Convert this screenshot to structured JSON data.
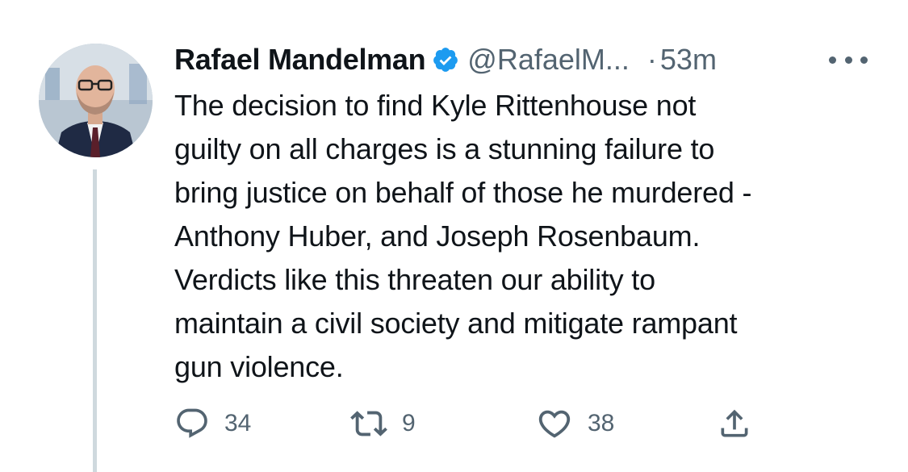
{
  "author": {
    "name": "Rafael Mandelman",
    "handle": "@RafaelM...",
    "verified": true,
    "separator": "·",
    "time": "53m"
  },
  "tweet": {
    "text": "The decision to find Kyle Rittenhouse not\nguilty on all charges is a stunning failure to\nbring justice on behalf of those he murdered -\nAnthony Huber, and Joseph Rosenbaum.\nVerdicts like this threaten our ability to\nmaintain a civil society and mitigate rampant\ngun violence."
  },
  "actions": {
    "reply": {
      "icon": "reply-icon",
      "count": "34"
    },
    "retweet": {
      "icon": "retweet-icon",
      "count": "9"
    },
    "like": {
      "icon": "heart-icon",
      "count": "38"
    },
    "share": {
      "icon": "share-icon"
    }
  },
  "colors": {
    "text": "#0f1419",
    "secondary": "#536471",
    "verified": "#1d9bf0",
    "thread_line": "#cfd9de"
  }
}
